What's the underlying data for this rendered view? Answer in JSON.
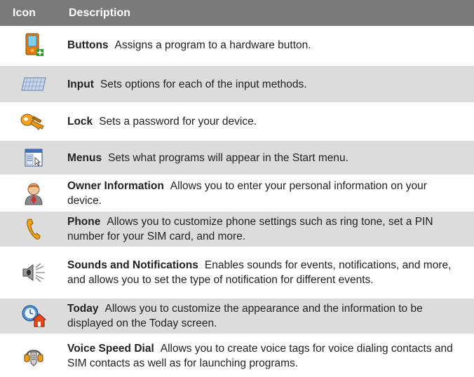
{
  "header": {
    "icon_col": "Icon",
    "desc_col": "Description"
  },
  "rows": [
    {
      "icon": "pda-plus-icon",
      "name": "Buttons",
      "text": "Assigns a program to a hardware button."
    },
    {
      "icon": "keyboard-icon",
      "name": "Input",
      "text": "Sets options for each of the input methods."
    },
    {
      "icon": "keys-icon",
      "name": "Lock",
      "text": "Sets a password for your device."
    },
    {
      "icon": "menu-window-icon",
      "name": "Menus",
      "text": "Sets what programs will appear in the Start menu."
    },
    {
      "icon": "person-icon",
      "name": "Owner Information",
      "text": "Allows you to enter your personal information on your device."
    },
    {
      "icon": "phone-handset-icon",
      "name": "Phone",
      "text": "Allows you to customize phone settings such as ring tone, set a PIN number for your SIM card, and more."
    },
    {
      "icon": "speaker-icon",
      "name": "Sounds and Notifications",
      "text": "Enables sounds for events, notifications, and more, and allows you to set the type of notification for different events."
    },
    {
      "icon": "today-clock-house-icon",
      "name": "Today",
      "text": "Allows you to customize the appearance and the information to be displayed on the Today screen."
    },
    {
      "icon": "voice-headset-icon",
      "name": "Voice Speed Dial",
      "text": "Allows you to create voice tags for voice dialing contacts and SIM contacts as well as for launching programs."
    }
  ]
}
